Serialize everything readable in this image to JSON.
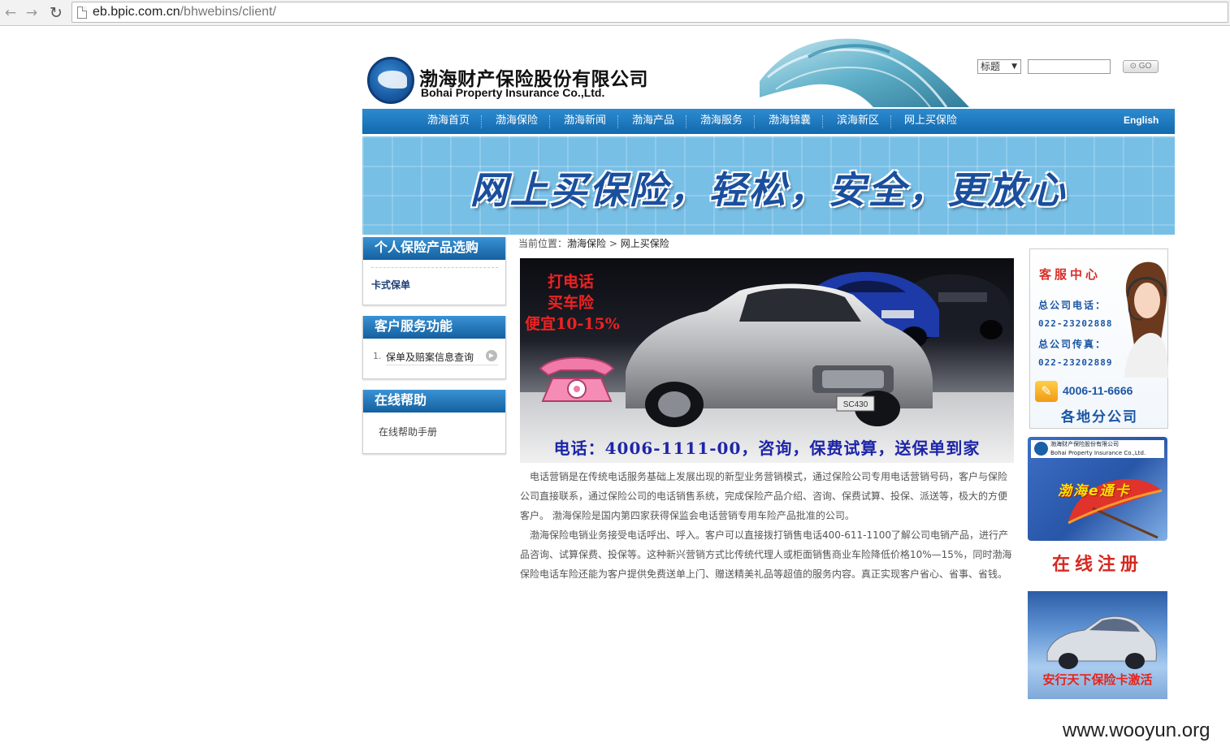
{
  "browser": {
    "url_host": "eb.bpic.com.cn",
    "url_path": "/bhwebins/client/",
    "back_icon": "←",
    "forward_icon": "→",
    "reload_icon": "↻"
  },
  "header": {
    "company_cn": "渤海财产保险股份有限公司",
    "company_en": "Bohai Property Insurance Co.,Ltd.",
    "search": {
      "select_value": "标题",
      "select_arrow": "▼",
      "input_value": "",
      "go_label": "GO"
    }
  },
  "nav": {
    "items": [
      "渤海首页",
      "渤海保险",
      "渤海新闻",
      "渤海产品",
      "渤海服务",
      "渤海锦囊",
      "滨海新区",
      "网上买保险"
    ],
    "english": "English",
    "colors": {
      "bar": "#1a74bb"
    }
  },
  "banner": {
    "text": "网上买保险，轻松，安全，更放心"
  },
  "sidebar": {
    "products": {
      "title": "个人保险产品选购",
      "links": [
        "卡式保单"
      ]
    },
    "services": {
      "title": "客户服务功能",
      "items": [
        {
          "num": "1.",
          "label": "保单及赔案信息查询"
        }
      ],
      "arrow_icon": "▶"
    },
    "help": {
      "title": "在线帮助",
      "links": [
        "在线帮助手册"
      ]
    }
  },
  "main": {
    "breadcrumb": {
      "prefix": "当前位置：",
      "items": [
        "渤海保险",
        "网上买保险"
      ],
      "separator": ">"
    },
    "hero": {
      "line1": "打电话",
      "line2": "买车险",
      "line3": "便宜10-15%",
      "phone_text": "电话：4006-1111-00，咨询，保费试算，送保单到家",
      "plate": "SC430"
    },
    "article": [
      "电话营销是在传统电话服务基础上发展出现的新型业务营销模式，通过保险公司专用电话营销号码，客户与保险公司直接联系，通过保险公司的电话销售系统，完成保险产品介绍、咨询、保费试算、投保、派送等，极大的方便客户。 渤海保险是国内第四家获得保监会电话营销专用车险产品批准的公司。",
      "渤海保险电销业务接受电话呼出、呼入。客户可以直接拨打销售电话400-611-1100了解公司电销产品，进行产品咨询、试算保费、投保等。这种新兴营销方式比传统代理人或柜面销售商业车险降低价格10%—15%，同时渤海保险电话车险还能为客户提供免费送单上门、赠送精美礼品等超值的服务内容。真正实现客户省心、省事、省钱。"
    ]
  },
  "right": {
    "service_center": {
      "title": "客服中心",
      "hq_phone_label": "总公司电话：",
      "hq_phone": "022-23202888",
      "hq_fax_label": "总公司传真：",
      "hq_fax": "022-23202889",
      "hotline": "4006-11-6666",
      "hotline_icon": "✎",
      "branches": "各地分公司"
    },
    "ecard": {
      "header_cn": "渤海财产保险股份有限公司",
      "header_en": "Bohai Property Insurance Co.,Ltd.",
      "text": "渤海e通卡"
    },
    "register": "在线注册",
    "activate": "安行天下保险卡激活"
  },
  "watermark": "www.wooyun.org"
}
